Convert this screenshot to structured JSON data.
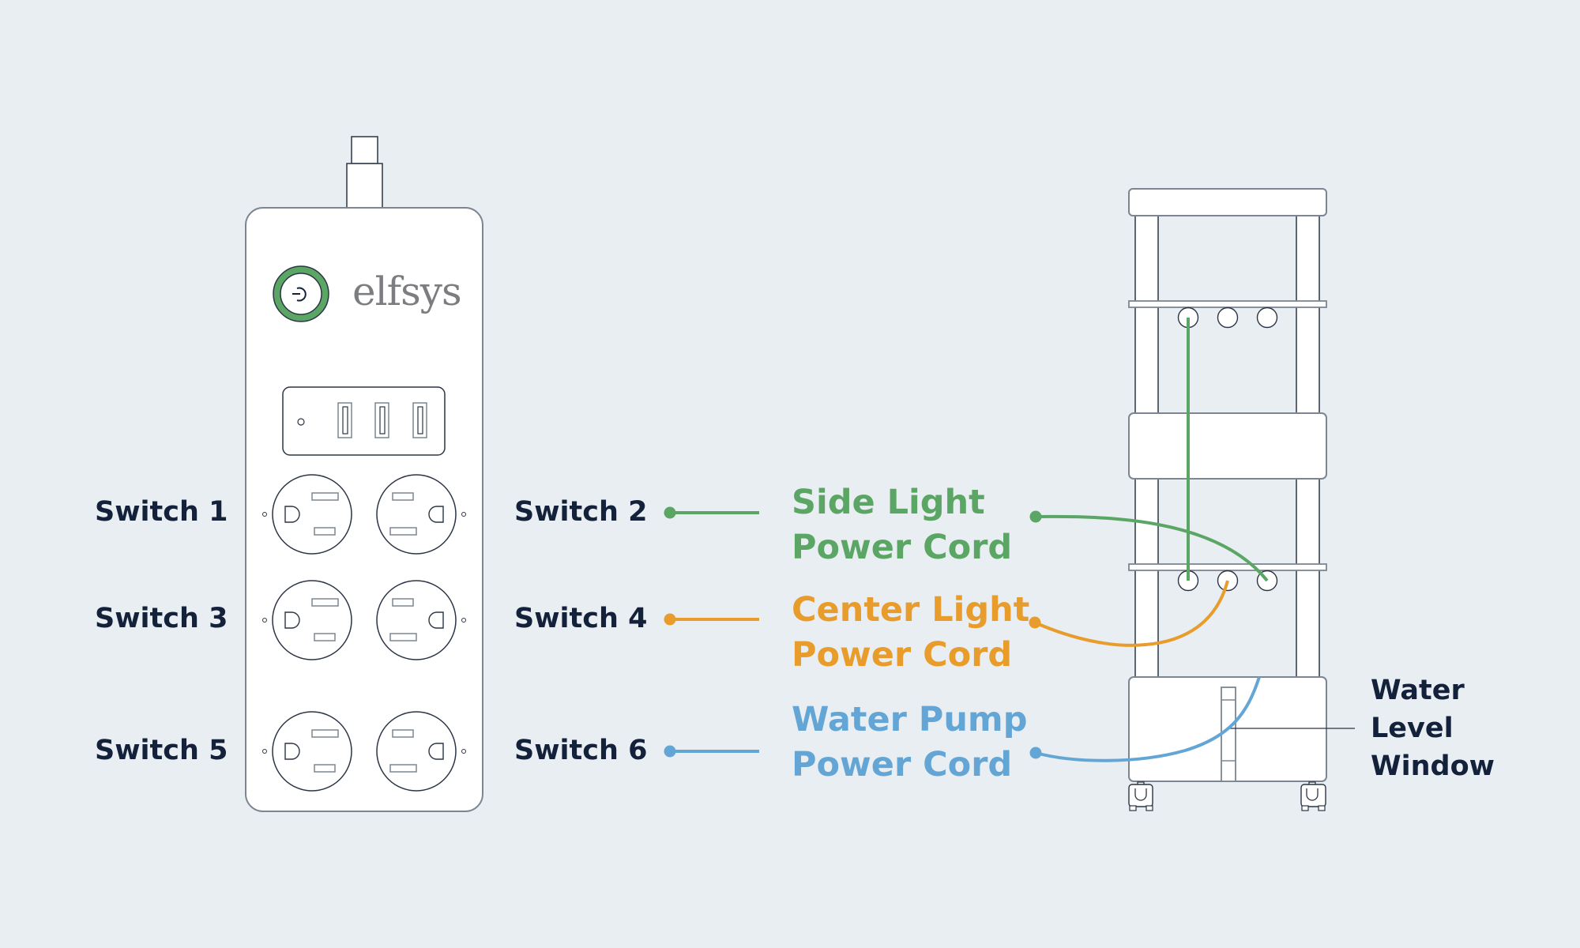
{
  "colors": {
    "background": "#e9eef2",
    "outline": "#2b3545",
    "outline_soft": "#7c8591",
    "fill": "#ffffff",
    "text_dark": "#14213a",
    "brand_text": "#7b7d80",
    "side_light": "#5ba664",
    "center_light": "#e89c2b",
    "water_pump": "#63a6d6",
    "power_ring": "#5ba664"
  },
  "power_strip": {
    "brand": "elfsys",
    "power_button_icon": "power-icon",
    "usb_port_count": 3,
    "outlet_count": 6
  },
  "switches": [
    {
      "label": "Switch 1"
    },
    {
      "label": "Switch 2"
    },
    {
      "label": "Switch 3"
    },
    {
      "label": "Switch 4"
    },
    {
      "label": "Switch 5"
    },
    {
      "label": "Switch 6"
    }
  ],
  "cords": [
    {
      "line1": "Side Light",
      "line2": "Power Cord",
      "switch": "Switch 2",
      "color_key": "side_light"
    },
    {
      "line1": "Center Light",
      "line2": "Power Cord",
      "switch": "Switch 4",
      "color_key": "center_light"
    },
    {
      "line1": "Water Pump",
      "line2": "Power Cord",
      "switch": "Switch 6",
      "color_key": "water_pump"
    }
  ],
  "tower": {
    "water_level_label": [
      "Water",
      "Level",
      "Window"
    ]
  }
}
